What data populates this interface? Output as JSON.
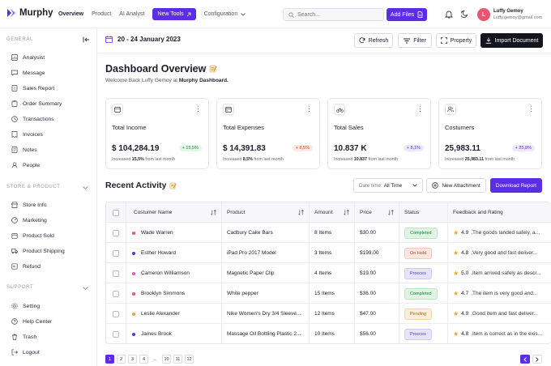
{
  "brand": {
    "name": "Murphy",
    "accent": "#5b2ee6"
  },
  "topnav": {
    "items": [
      "Overview",
      "Product",
      "AI Analyst"
    ],
    "new_tools": "New Tools",
    "configuration": "Configuration",
    "search_placeholder": "Search...",
    "add_files": "Add Files"
  },
  "user": {
    "initial": "L",
    "name": "Luffy Gemoy",
    "email": "Luffy.gemoy@gmail.com"
  },
  "sidebar": {
    "general_title": "GENERAL",
    "general_items": [
      "Analysist",
      "Message",
      "Sales Report",
      "Order Summary",
      "Transactions",
      "Invoices",
      "Notes",
      "People"
    ],
    "store_title": "STORE & PRODUCT",
    "store_items": [
      "Store Info",
      "Marketing",
      "Product Sold",
      "Product Shipping",
      "Refund"
    ],
    "support_title": "SUPPORT",
    "support_items": [
      "Setting",
      "Help Center",
      "Trash",
      "Logout"
    ]
  },
  "toolbar": {
    "date_range": "20 - 24 January 2023",
    "refresh": "Refresh",
    "filter": "Filter",
    "property": "Property",
    "import": "Import Document"
  },
  "dashboard": {
    "title": "Dashboard Overview",
    "subtitle_prefix": "Welcome Back Luffy Gemoy at",
    "subtitle_bold": "Murphy Dashboard."
  },
  "cards": [
    {
      "icon": "wallet-icon",
      "title": "Total Income",
      "value": "$ 104,284.19",
      "badge": "+ 15,5%",
      "badge_type": "up",
      "note_prefix": "Increased",
      "note_bold": "15,5%",
      "note_suffix": "from last month"
    },
    {
      "icon": "card-icon",
      "title": "Total Expenses",
      "value": "$ 14,391.83",
      "badge": "+ 8,5%",
      "badge_type": "down",
      "note_prefix": "Increased",
      "note_bold": "8,5%",
      "note_suffix": "from last month"
    },
    {
      "icon": "bike-icon",
      "title": "Total Sales",
      "value": "10.837 K",
      "badge": "+ 8,1%",
      "badge_type": "purple",
      "note_prefix": "Increased",
      "note_bold": "10.837",
      "note_suffix": "from last month"
    },
    {
      "icon": "users-icon",
      "title": "Costumers",
      "value": "25,983.11",
      "badge": "+ 25,8%",
      "badge_type": "purple",
      "note_prefix": "Increased",
      "note_bold": "25,983.11",
      "note_suffix": "from last month"
    }
  ],
  "activity": {
    "title": "Recent Activity",
    "date_label": "Date time:",
    "date_value": "All Time",
    "new_attachment": "New Attachment",
    "download": "Download Report"
  },
  "table": {
    "headers": [
      "Costumer Name",
      "Product",
      "Amount",
      "Price",
      "Status",
      "Feedback and Rating"
    ],
    "rows": [
      {
        "name": "Wade Warren",
        "dot": "#e8566f",
        "product": "Cadbury Cake Bars",
        "amount": "8 Items",
        "price": "$30.00",
        "status": "Completed",
        "status_type": "completed",
        "rating": "4.9",
        "feedback": ",The goods landed safely, a..."
      },
      {
        "name": "Esther Howard",
        "dot": "#5b2ee6",
        "product": "iPad Pro 2017 Model",
        "amount": "3 Items",
        "price": "$199.00",
        "status": "On Hold",
        "status_type": "onhold",
        "rating": "4.8",
        "feedback": ",Very good and fast deliver..."
      },
      {
        "name": "Cameron Williamson",
        "dot": "#e05bd0",
        "product": "Magnetic Paper Clip",
        "amount": "4 Items",
        "price": "$19.00",
        "status": "Procces",
        "status_type": "procces",
        "rating": "5.0",
        "feedback": ",Item arrived safely as descr..."
      },
      {
        "name": "Brooklyn Simmons",
        "dot": "#e8566f",
        "product": "White pepper",
        "amount": "15 Items",
        "price": "$36.00",
        "status": "Completed",
        "status_type": "completed",
        "rating": "4.7",
        "feedback": ",The item is very good and..."
      },
      {
        "name": "Leslie Alexander",
        "dot": "#f2a03d",
        "product": "Nike Women's Dry 3/4 Sleeve...",
        "amount": "12 Items",
        "price": "$47.00",
        "status": "Pending",
        "status_type": "pending",
        "rating": "4.9",
        "feedback": ",Good item and fast deliver..."
      },
      {
        "name": "James Brook",
        "dot": "#5b2ee6",
        "product": "Massage Oil Bottling Plastic 2...",
        "amount": "10 Items",
        "price": "$56.00",
        "status": "Procces",
        "status_type": "procces",
        "rating": "4.8",
        "feedback": ",Item is correct as in the exis..."
      }
    ]
  },
  "pagination": {
    "pages": [
      "1",
      "2",
      "3",
      "4",
      "...",
      "10",
      "11",
      "12"
    ],
    "active": "1"
  }
}
